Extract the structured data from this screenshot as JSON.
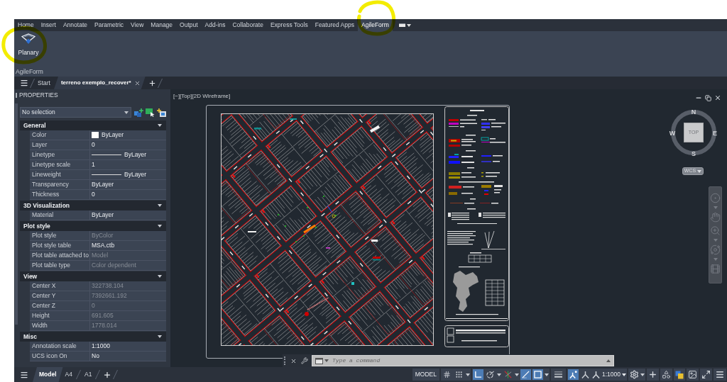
{
  "ribbon": {
    "tabs": [
      {
        "label": "Home",
        "selected": false
      },
      {
        "label": "Insert",
        "selected": false
      },
      {
        "label": "Annotate",
        "selected": false
      },
      {
        "label": "Parametric",
        "selected": false
      },
      {
        "label": "View",
        "selected": false
      },
      {
        "label": "Manage",
        "selected": false
      },
      {
        "label": "Output",
        "selected": false
      },
      {
        "label": "Add-ins",
        "selected": false
      },
      {
        "label": "Collaborate",
        "selected": false
      },
      {
        "label": "Express Tools",
        "selected": false
      },
      {
        "label": "Featured Apps",
        "selected": false
      },
      {
        "label": "AgileForm",
        "selected": true
      }
    ],
    "panel": {
      "title": "AgileForm",
      "buttons": [
        {
          "label": "Planary"
        }
      ]
    }
  },
  "file_tabs": [
    {
      "label": "Start",
      "selected": false
    },
    {
      "label": "terreno exemplo_recover*",
      "selected": true
    }
  ],
  "properties": {
    "title": "PROPERTIES",
    "selection": "No selection",
    "sections": [
      {
        "title": "General",
        "expanded": true,
        "rows": [
          {
            "label": "Color",
            "value": "ByLayer",
            "kind": "swatch",
            "color": "#ffffff",
            "disabled": false
          },
          {
            "label": "Layer",
            "value": "0",
            "kind": "text",
            "disabled": false
          },
          {
            "label": "Linetype",
            "value": "ByLayer",
            "kind": "line",
            "disabled": false
          },
          {
            "label": "Linetype scale",
            "value": "1",
            "kind": "text",
            "disabled": false
          },
          {
            "label": "Lineweight",
            "value": "ByLayer",
            "kind": "line",
            "disabled": false
          },
          {
            "label": "Transparency",
            "value": "ByLayer",
            "kind": "text",
            "disabled": false
          },
          {
            "label": "Thickness",
            "value": "0",
            "kind": "text",
            "disabled": false
          }
        ]
      },
      {
        "title": "3D Visualization",
        "expanded": true,
        "rows": [
          {
            "label": "Material",
            "value": "ByLayer",
            "kind": "text",
            "disabled": false
          }
        ]
      },
      {
        "title": "Plot style",
        "expanded": true,
        "rows": [
          {
            "label": "Plot style",
            "value": "ByColor",
            "kind": "text",
            "disabled": true
          },
          {
            "label": "Plot style table",
            "value": "MSA.ctb",
            "kind": "text",
            "disabled": false
          },
          {
            "label": "Plot table attached to",
            "value": "Model",
            "kind": "text",
            "disabled": true
          },
          {
            "label": "Plot table type",
            "value": "Color dependent",
            "kind": "text",
            "disabled": true
          }
        ]
      },
      {
        "title": "View",
        "expanded": true,
        "rows": [
          {
            "label": "Center X",
            "value": "322738.104",
            "kind": "text",
            "disabled": true
          },
          {
            "label": "Center Y",
            "value": "7392661.192",
            "kind": "text",
            "disabled": true
          },
          {
            "label": "Center Z",
            "value": "0",
            "kind": "text",
            "disabled": true
          },
          {
            "label": "Height",
            "value": "691.605",
            "kind": "text",
            "disabled": true
          },
          {
            "label": "Width",
            "value": "1778.014",
            "kind": "text",
            "disabled": true
          }
        ]
      },
      {
        "title": "Misc",
        "expanded": true,
        "rows": [
          {
            "label": "Annotation scale",
            "value": "1:1000",
            "kind": "text",
            "disabled": false
          },
          {
            "label": "UCS icon On",
            "value": "No",
            "kind": "text",
            "disabled": false
          }
        ]
      }
    ]
  },
  "viewport": {
    "controls": [
      "[−]",
      "[Top]",
      "[2D Wireframe]"
    ],
    "viewcube": {
      "north": "N",
      "east": "E",
      "south": "S",
      "west": "W",
      "face": "TOP"
    },
    "ucs_menu": "WCS"
  },
  "command_line": {
    "placeholder": "Type a command"
  },
  "layout_tabs": [
    {
      "label": "Model",
      "selected": true
    },
    {
      "label": "A4",
      "selected": false
    },
    {
      "label": "A1",
      "selected": false
    }
  ],
  "status_bar": {
    "space": "MODEL",
    "toggles": [
      {
        "on": false
      },
      {
        "on": false
      },
      {
        "on": true
      },
      {
        "on": false
      },
      {
        "on": false
      },
      {
        "on": true
      },
      {
        "on": true
      },
      {
        "on": false
      },
      {
        "on": true
      },
      {
        "on": false
      }
    ],
    "annotation_scale": "1:1000"
  }
}
